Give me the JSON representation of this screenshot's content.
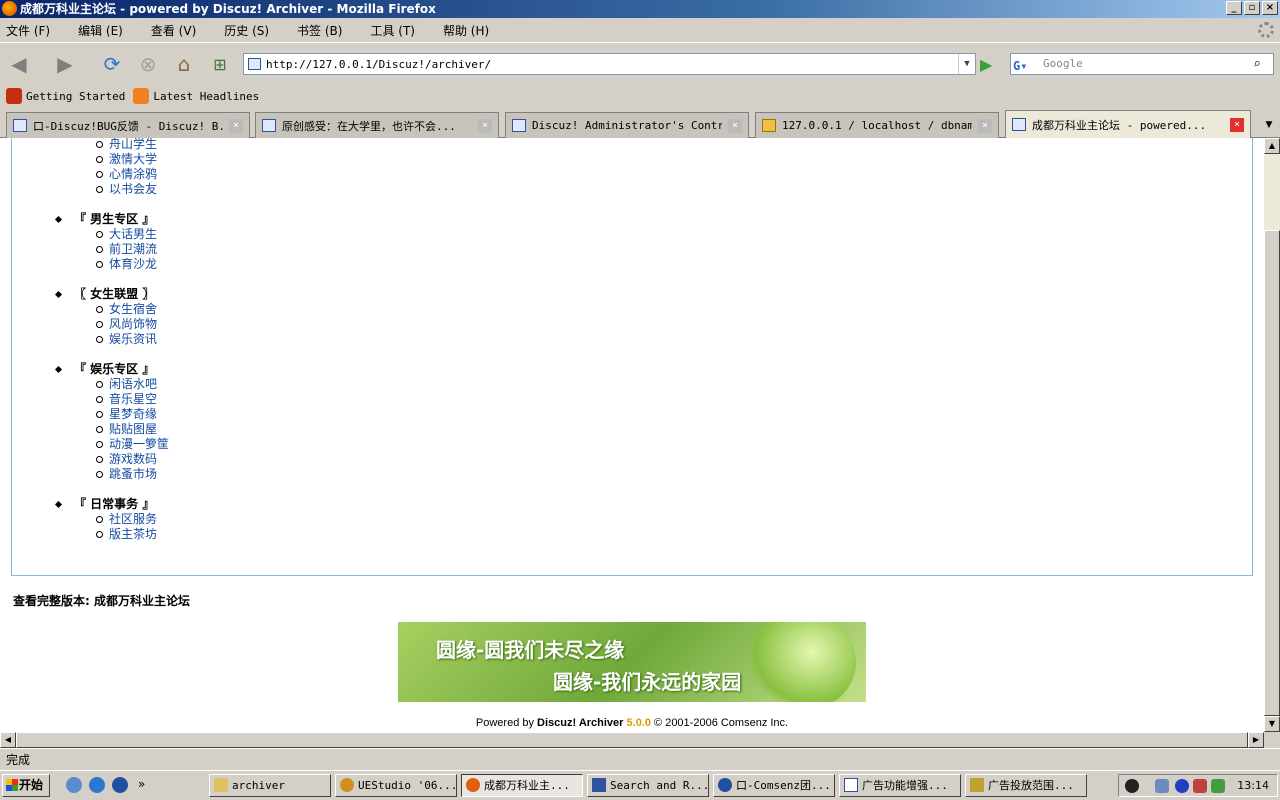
{
  "window": {
    "title": "成都万科业主论坛 - powered by Discuz! Archiver - Mozilla Firefox"
  },
  "menu": [
    "文件 (F)",
    "编辑 (E)",
    "查看 (V)",
    "历史 (S)",
    "书签 (B)",
    "工具 (T)",
    "帮助 (H)"
  ],
  "nav": {
    "url": "http://127.0.0.1/Discuz!/archiver/",
    "search_placeholder": "Google"
  },
  "bookmarks": [
    {
      "label": "Getting Started",
      "icon": "firefox-icon"
    },
    {
      "label": "Latest Headlines",
      "icon": "rss-icon"
    }
  ],
  "tabs": [
    {
      "label": "口-Discuz!BUG反馈 - Discuz! B...",
      "active": false
    },
    {
      "label": "原创感受：在大学里，也许不会...",
      "active": false
    },
    {
      "label": "Discuz! Administrator's Contr...",
      "active": false
    },
    {
      "label": "127.0.0.1 / localhost / dbnam...",
      "active": false
    },
    {
      "label": "成都万科业主论坛 - powered...",
      "active": true
    }
  ],
  "forums": [
    {
      "name": "",
      "subs": [
        "舟山学生",
        "激情大学",
        "心情涂鸦",
        "以书会友"
      ]
    },
    {
      "name": "『 男生专区 』",
      "subs": [
        "大话男生",
        "前卫潮流",
        "体育沙龙"
      ]
    },
    {
      "name": "〖 女生联盟 〗",
      "subs": [
        "女生宿舍",
        "风尚饰物",
        "娱乐资讯"
      ]
    },
    {
      "name": "『 娱乐专区 』",
      "subs": [
        "闲语水吧",
        "音乐星空",
        "星梦奇缘",
        "贴贴图屋",
        "动漫一箩筐",
        "游戏数码",
        "跳蚤市场"
      ]
    },
    {
      "name": "『 日常事务 』",
      "subs": [
        "社区服务",
        "版主茶坊"
      ]
    }
  ],
  "footer": {
    "full_version": "查看完整版本: 成都万科业主论坛",
    "banner_line1": "圆缘-圆我们未尽之缘",
    "banner_line2": "圆缘-我们永远的家园",
    "powered_prefix": "Powered by ",
    "powered_brand": "Discuz! Archiver",
    "powered_version": "5.0.0",
    "powered_suffix": "  © 2001-2006 Comsenz Inc."
  },
  "status": "完成",
  "taskbar": {
    "start": "开始",
    "tasks": [
      {
        "label": "archiver",
        "active": false
      },
      {
        "label": "UEStudio '06...",
        "active": false
      },
      {
        "label": "成都万科业主...",
        "active": true
      },
      {
        "label": "Search and R...",
        "active": false
      },
      {
        "label": "口-Comsenz团...",
        "active": false
      },
      {
        "label": "广告功能增强...",
        "active": false
      },
      {
        "label": "广告投放范围...",
        "active": false
      }
    ],
    "clock": "13:14"
  }
}
